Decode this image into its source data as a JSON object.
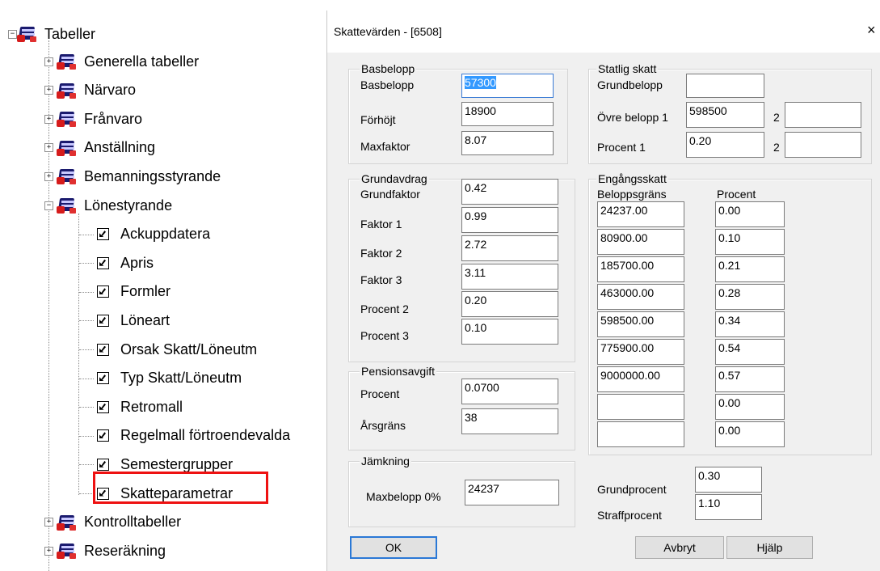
{
  "tree": {
    "root": "Tabeller",
    "groups_before": [
      "Generella tabeller",
      "Närvaro",
      "Frånvaro",
      "Anställning",
      "Bemanningsstyrande"
    ],
    "expanded_group": "Lönestyrande",
    "children": [
      "Ackuppdatera",
      "Apris",
      "Formler",
      "Löneart",
      "Orsak Skatt/Löneutm",
      "Typ Skatt/Löneutm",
      "Retromall",
      "Regelmall förtroendevalda",
      "Semestergrupper",
      "Skatteparametrar"
    ],
    "selected_child": "Skatteparametrar",
    "groups_after": [
      "Kontrolltabeller",
      "Reseräkning"
    ]
  },
  "dialog": {
    "title": "Skattevärden - [6508]",
    "close": "×",
    "basbelopp": {
      "caption": "Basbelopp",
      "rows": [
        {
          "label": "Basbelopp",
          "value": "57300"
        },
        {
          "label": "Förhöjt",
          "value": "18900"
        },
        {
          "label": "Maxfaktor",
          "value": "8.07"
        }
      ]
    },
    "statlig": {
      "caption": "Statlig skatt",
      "grundbelopp_label": "Grundbelopp",
      "grundbelopp_value": "",
      "ovre_label": "Övre belopp 1",
      "ovre_value": "598500",
      "ovre2_label": "2",
      "ovre2_value": "",
      "procent_label": "Procent  1",
      "procent_value": "0.20",
      "procent2_label": "2",
      "procent2_value": ""
    },
    "grundavdrag": {
      "caption": "Grundavdrag",
      "rows": [
        {
          "label": "Grundfaktor",
          "value": "0.42"
        },
        {
          "label": "Faktor 1",
          "value": "0.99"
        },
        {
          "label": "Faktor 2",
          "value": "2.72"
        },
        {
          "label": "Faktor 3",
          "value": "3.11"
        },
        {
          "label": "Procent 2",
          "value": "0.20"
        },
        {
          "label": "Procent 3",
          "value": "0.10"
        }
      ]
    },
    "pension": {
      "caption": "Pensionsavgift",
      "rows": [
        {
          "label": "Procent",
          "value": "0.0700"
        },
        {
          "label": "Årsgräns",
          "value": "38"
        }
      ]
    },
    "jamkning": {
      "caption": "Jämkning",
      "label": "Maxbelopp 0%",
      "value": "24237"
    },
    "engangsskatt": {
      "caption": "Engångsskatt",
      "col1_header": "Beloppsgräns",
      "col2_header": "Procent",
      "rows": [
        {
          "belopp": "24237.00",
          "procent": "0.00"
        },
        {
          "belopp": "80900.00",
          "procent": "0.10"
        },
        {
          "belopp": "185700.00",
          "procent": "0.21"
        },
        {
          "belopp": "463000.00",
          "procent": "0.28"
        },
        {
          "belopp": "598500.00",
          "procent": "0.34"
        },
        {
          "belopp": "775900.00",
          "procent": "0.54"
        },
        {
          "belopp": "9000000.00",
          "procent": "0.57"
        },
        {
          "belopp": "",
          "procent": "0.00"
        },
        {
          "belopp": "",
          "procent": "0.00"
        }
      ]
    },
    "grundprocent_label": "Grundprocent",
    "grundprocent_value": "0.30",
    "straffprocent_label": "Straffprocent",
    "straffprocent_value": "1.10",
    "ok_label": "OK",
    "avbryt_label": "Avbryt",
    "hjalp_label": "Hjälp"
  }
}
